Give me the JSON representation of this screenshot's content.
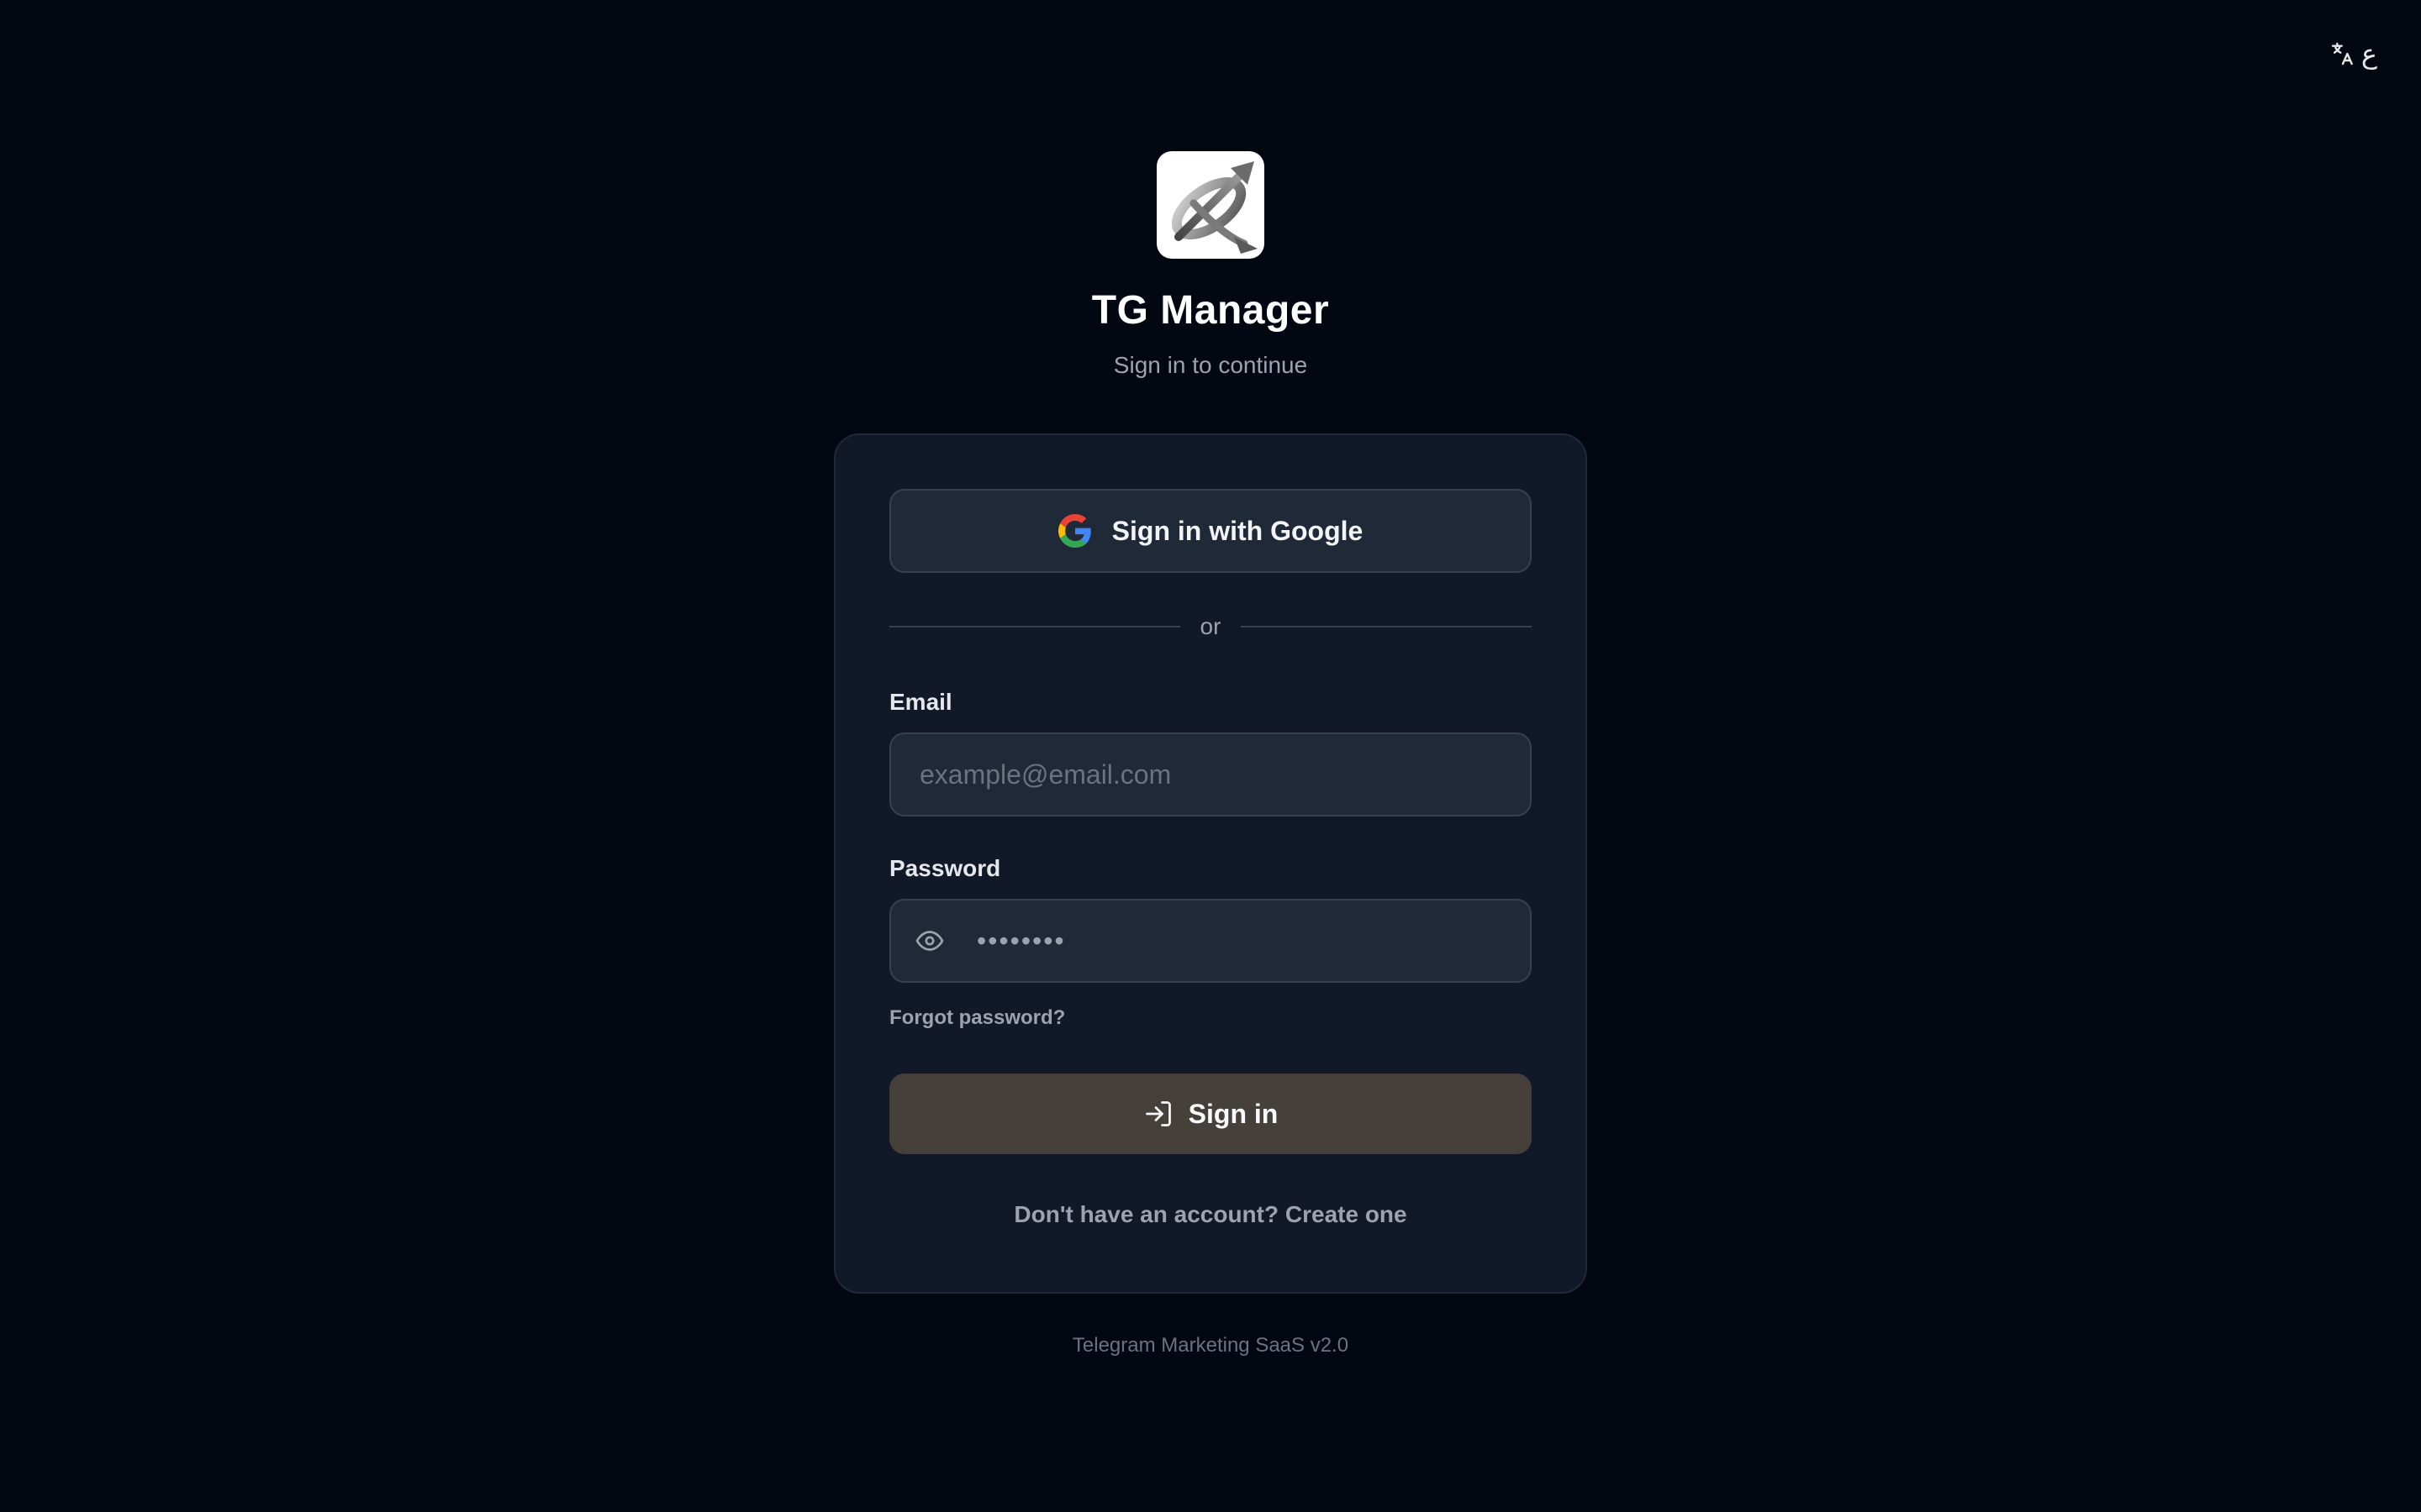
{
  "top_bar": {
    "language_label": "ع",
    "language_icon": "translate-icon"
  },
  "header": {
    "logo_icon": "app-logo-icon",
    "title": "TG Manager",
    "subtitle": "Sign in to continue"
  },
  "form": {
    "google_button_label": "Sign in with Google",
    "google_icon": "google-icon",
    "divider_text": "or",
    "email": {
      "label": "Email",
      "placeholder": "example@email.com",
      "value": ""
    },
    "password": {
      "label": "Password",
      "placeholder": "••••••••",
      "value": "",
      "toggle_icon": "eye-icon"
    },
    "forgot_password_label": "Forgot password?",
    "signin_button_label": "Sign in",
    "signin_icon": "login-icon",
    "no_account_text": "Don't have an account?",
    "create_account_label": "Create one"
  },
  "footer": {
    "text": "Telegram Marketing SaaS v2.0"
  },
  "colors": {
    "background": "#030712",
    "card": "#111827",
    "input": "#1f2937",
    "border": "#374151",
    "signin_button": "#45413a",
    "muted_text": "#9ca3af"
  }
}
